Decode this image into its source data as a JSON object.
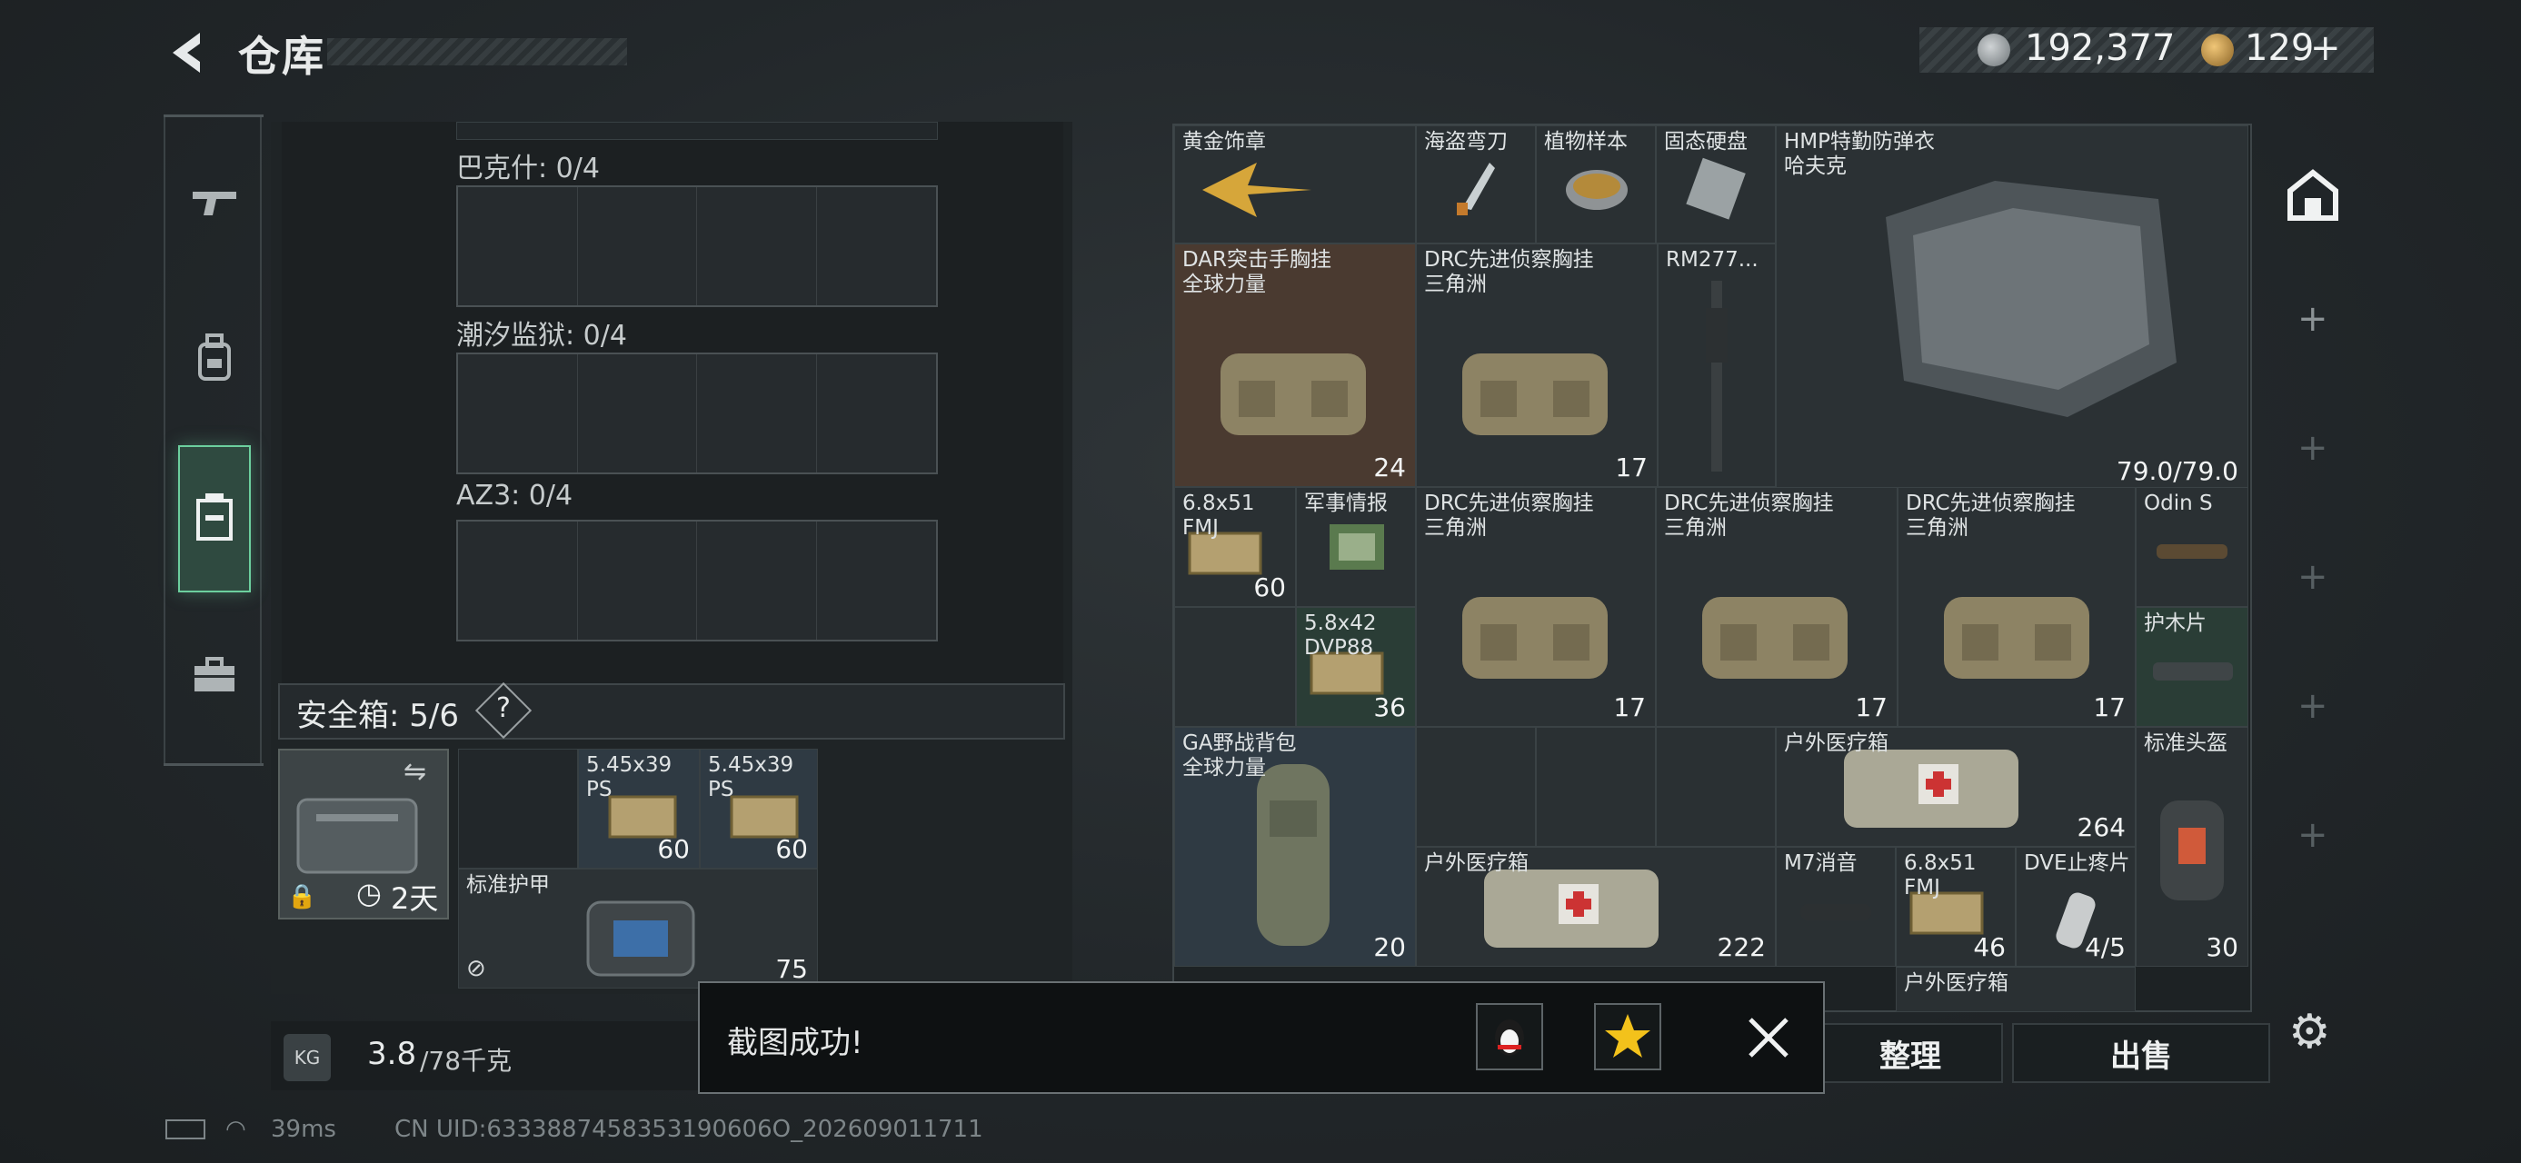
{
  "header": {
    "title": "仓库",
    "currency_silver": "192,377",
    "currency_gold": "129",
    "plus_label": "+"
  },
  "left_panel": {
    "cases": [
      {
        "label": "巴克什: 0/4"
      },
      {
        "label": "潮汐监狱: 0/4"
      },
      {
        "label": "AZ3: 0/4"
      }
    ],
    "safe_box": {
      "label": "安全箱: 5/6",
      "help": "?",
      "timer": "2天"
    },
    "safe_items": [
      {
        "label": "5.45x39\nPS",
        "count": "60"
      },
      {
        "label": "5.45x39\nPS",
        "count": "60"
      },
      {
        "label": "标准护甲",
        "count": "75"
      }
    ]
  },
  "right_grid": {
    "items": [
      {
        "name": "黄金饰章",
        "count": ""
      },
      {
        "name": "海盗弯刀",
        "count": ""
      },
      {
        "name": "植物样本",
        "count": ""
      },
      {
        "name": "固态硬盘",
        "count": ""
      },
      {
        "name": "HMP特勤防弹衣\n哈夫克",
        "count": "79.0/79.0"
      },
      {
        "name": "DAR突击手胸挂\n全球力量",
        "count": "24"
      },
      {
        "name": "DRC先进侦察胸挂\n三角洲",
        "count": "17"
      },
      {
        "name": "RM277...",
        "count": ""
      },
      {
        "name": "6.8x51\nFMJ",
        "count": "60"
      },
      {
        "name": "军事情报",
        "count": ""
      },
      {
        "name": "DRC先进侦察胸挂\n三角洲",
        "count": "17"
      },
      {
        "name": "DRC先进侦察胸挂\n三角洲",
        "count": "17"
      },
      {
        "name": "DRC先进侦察胸挂\n三角洲",
        "count": "17"
      },
      {
        "name": "Odin S",
        "count": ""
      },
      {
        "name": "5.8x42\nDVP88",
        "count": "36"
      },
      {
        "name": "护木片",
        "count": ""
      },
      {
        "name": "GA野战背包\n全球力量",
        "count": "20"
      },
      {
        "name": "户外医疗箱",
        "count": "264"
      },
      {
        "name": "标准头盔",
        "count": "30"
      },
      {
        "name": "户外医疗箱",
        "count": "222"
      },
      {
        "name": "M7消音",
        "count": ""
      },
      {
        "name": "6.8x51\nFMJ",
        "count": "46"
      },
      {
        "name": "DVE止疼片",
        "count": "4/5"
      },
      {
        "name": "户外医疗箱",
        "count": ""
      }
    ]
  },
  "bottom": {
    "weight_icon": "KG",
    "weight_current": "3.8",
    "weight_max": "/78千克",
    "sort_label": "整理",
    "sell_label": "出售"
  },
  "toast": {
    "message": "截图成功!"
  },
  "status": {
    "ping": "39ms",
    "uid": "CN UID:6333887458353190606O_202609011711"
  },
  "icons": {
    "back": "back-arrow-icon",
    "weapon": "gun-icon",
    "backpack": "backpack-icon",
    "storage": "storage-icon",
    "toolbox": "toolbox-icon",
    "settings": "gear-icon",
    "qq": "qq-penguin-icon",
    "qzone": "qzone-star-icon",
    "close": "close-icon"
  },
  "colors": {
    "accent_green": "#6ccf9e",
    "background": "#24292c"
  }
}
